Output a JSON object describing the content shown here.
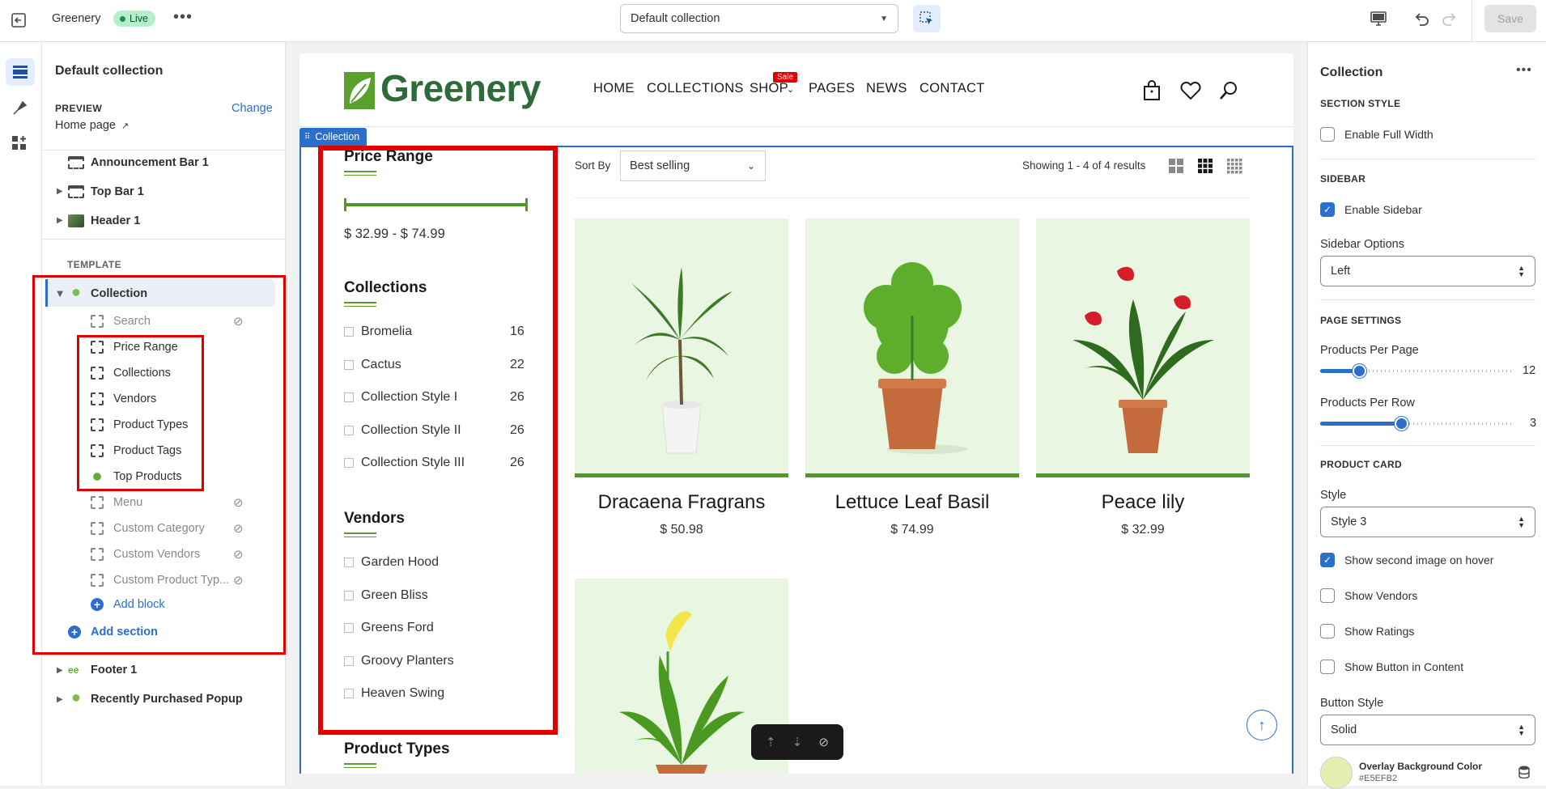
{
  "topbar": {
    "store_name": "Greenery",
    "live_badge": "Live",
    "template_select": "Default collection",
    "save_label": "Save"
  },
  "left": {
    "title": "Default collection",
    "preview_label": "PREVIEW",
    "preview_change": "Change",
    "preview_page": "Home page",
    "sections_top": [
      "Announcement Bar 1",
      "Top Bar 1",
      "Header 1"
    ],
    "template_label": "TEMPLATE",
    "collection_section": "Collection",
    "blocks": [
      {
        "label": "Search",
        "hidden": true
      },
      {
        "label": "Price Range",
        "hidden": false
      },
      {
        "label": "Collections",
        "hidden": false
      },
      {
        "label": "Vendors",
        "hidden": false
      },
      {
        "label": "Product Types",
        "hidden": false
      },
      {
        "label": "Product Tags",
        "hidden": false
      },
      {
        "label": "Top Products",
        "hidden": false
      },
      {
        "label": "Menu",
        "hidden": true
      },
      {
        "label": "Custom Category",
        "hidden": true
      },
      {
        "label": "Custom Vendors",
        "hidden": true
      },
      {
        "label": "Custom Product Typ...",
        "hidden": true
      }
    ],
    "add_block": "Add block",
    "add_section": "Add section",
    "sections_bottom": [
      "Footer 1",
      "Recently Purchased Popup"
    ]
  },
  "preview": {
    "logo_text": "Greenery",
    "nav": [
      "HOME",
      "COLLECTIONS",
      "SHOP",
      "PAGES",
      "NEWS",
      "CONTACT"
    ],
    "sale_badge": "Sale",
    "section_tag": "Collection",
    "price_range_title": "Price Range",
    "price_range_value": "$ 32.99 - $ 74.99",
    "collections_title": "Collections",
    "collections": [
      {
        "name": "Bromelia",
        "count": "16"
      },
      {
        "name": "Cactus",
        "count": "22"
      },
      {
        "name": "Collection Style I",
        "count": "26"
      },
      {
        "name": "Collection Style II",
        "count": "26"
      },
      {
        "name": "Collection Style III",
        "count": "26"
      }
    ],
    "vendors_title": "Vendors",
    "vendors": [
      "Garden Hood",
      "Green Bliss",
      "Greens Ford",
      "Groovy Planters",
      "Heaven Swing"
    ],
    "product_types_title": "Product Types",
    "sort_label": "Sort By",
    "sort_value": "Best selling",
    "results_text": "Showing 1 - 4 of 4 results",
    "products": [
      {
        "name": "Dracaena Fragrans",
        "price": "$ 50.98"
      },
      {
        "name": "Lettuce Leaf Basil",
        "price": "$ 74.99"
      },
      {
        "name": "Peace lily",
        "price": "$ 32.99"
      }
    ]
  },
  "right": {
    "title": "Collection",
    "section_style": "SECTION STYLE",
    "enable_full_width": "Enable Full Width",
    "sidebar_heading": "SIDEBAR",
    "enable_sidebar": "Enable Sidebar",
    "sidebar_options_label": "Sidebar Options",
    "sidebar_options_value": "Left",
    "page_settings": "PAGE SETTINGS",
    "products_per_page_label": "Products Per Page",
    "products_per_page_value": "12",
    "products_per_page_fraction": 0.2,
    "products_per_row_label": "Products Per Row",
    "products_per_row_value": "3",
    "products_per_row_fraction": 0.42,
    "product_card": "PRODUCT CARD",
    "style_label": "Style",
    "style_value": "Style 3",
    "show_second_image": "Show second image on hover",
    "show_vendors": "Show Vendors",
    "show_ratings": "Show Ratings",
    "show_button_in_content": "Show Button in Content",
    "button_style_label": "Button Style",
    "button_style_value": "Solid",
    "overlay_bg_label": "Overlay Background Color",
    "overlay_bg_value": "#E5EFB2"
  },
  "colors": {
    "accent_blue": "#2c6ecb",
    "brand_green": "#4e9a26",
    "highlight_red": "#e00000",
    "overlay_swatch": "#E5EFB2"
  }
}
